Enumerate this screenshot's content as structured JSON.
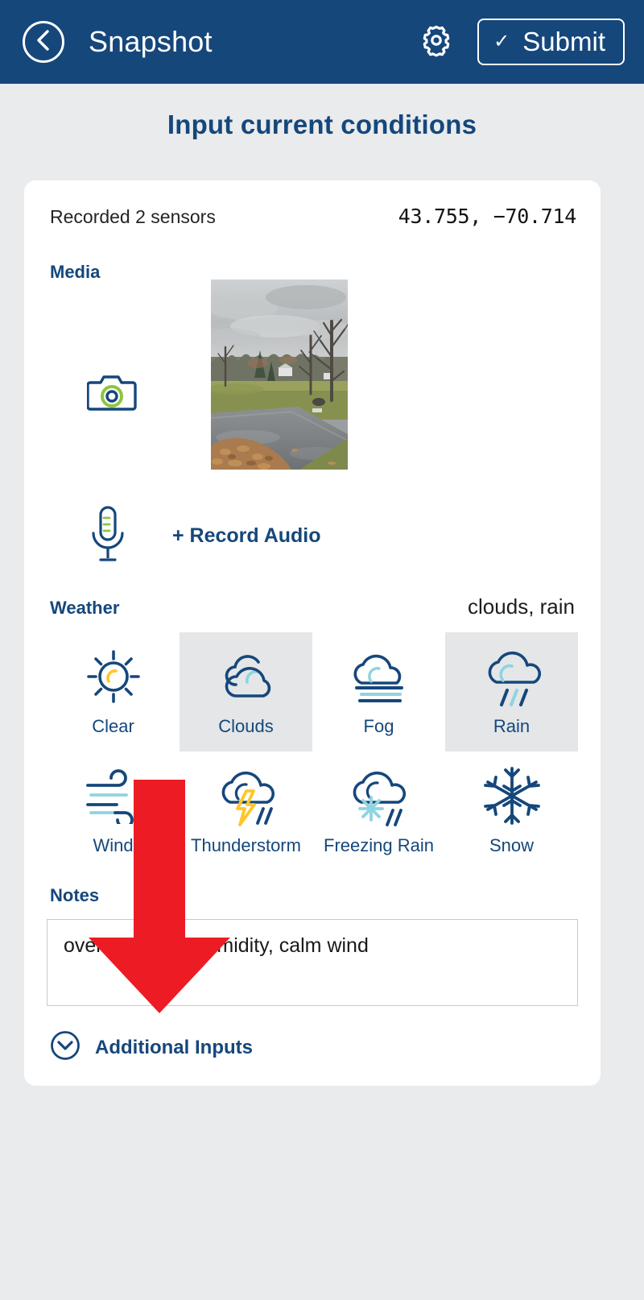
{
  "appbar": {
    "back_icon": "chevron-left-circle-icon",
    "title": "Snapshot",
    "gear_icon": "gear-icon",
    "submit_check": "✓",
    "submit_label": "Submit"
  },
  "page": {
    "heading": "Input current conditions",
    "accent_blue": "#15477b",
    "header_bg": "#15477b",
    "page_bg": "#e9ebed",
    "card_bg": "#ffffff",
    "selected_bg": "#e4e6e8",
    "green": "#8cc63e",
    "light_blue": "#8fd4e0",
    "yellow": "#ffc629",
    "annotation_red": "#ed1c24"
  },
  "card": {
    "recorded_text": "Recorded 2 sensors",
    "coordinates": "43.755, −70.714",
    "media": {
      "label": "Media",
      "camera_icon": "camera-icon",
      "photo_alt": "overcast rural driveway with bare trees and fallen leaves",
      "mic_icon": "microphone-icon",
      "record_audio_label": "+ Record Audio"
    },
    "weather": {
      "label": "Weather",
      "summary": "clouds, rain",
      "options": [
        {
          "label": "Clear",
          "icon": "sun-icon",
          "selected": false
        },
        {
          "label": "Clouds",
          "icon": "clouds-icon",
          "selected": true
        },
        {
          "label": "Fog",
          "icon": "fog-icon",
          "selected": false
        },
        {
          "label": "Rain",
          "icon": "rain-icon",
          "selected": true
        },
        {
          "label": "Wind",
          "icon": "wind-icon",
          "selected": false
        },
        {
          "label": "Thunderstorm",
          "icon": "thunderstorm-icon",
          "selected": false
        },
        {
          "label": "Freezing Rain",
          "icon": "freezing-rain-icon",
          "selected": false
        },
        {
          "label": "Snow",
          "icon": "snowflake-icon",
          "selected": false
        }
      ]
    },
    "notes": {
      "label": "Notes",
      "value": "overcast, high humidity, calm wind",
      "placeholder": ""
    },
    "additional": {
      "label": "Additional Inputs",
      "chevron_icon": "chevron-down-circle-icon"
    }
  },
  "annotation": {
    "arrow_icon": "down-arrow-annotation",
    "color": "#ed1c24"
  }
}
